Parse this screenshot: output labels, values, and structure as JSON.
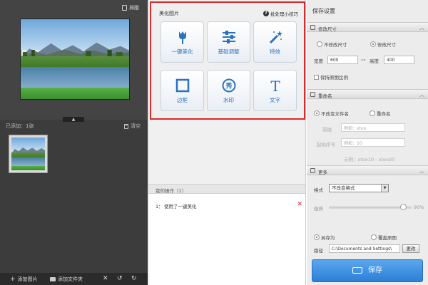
{
  "left_panel": {
    "sort_label": "排版",
    "added_label": "已添加：1张",
    "clear_label": "清空",
    "bottom": {
      "add_image": "添加图片",
      "add_folder": "添加文件夹"
    }
  },
  "beautify": {
    "title": "美化图片",
    "tips": "批处理小技巧",
    "tools": [
      {
        "label": "一键美化",
        "icon": "tulip-icon"
      },
      {
        "label": "基础调整",
        "icon": "sliders-icon"
      },
      {
        "label": "特效",
        "icon": "magic-wand-icon"
      },
      {
        "label": "边框",
        "icon": "frame-icon"
      },
      {
        "label": "水印",
        "icon": "watermark-icon"
      },
      {
        "label": "文字",
        "icon": "text-icon"
      }
    ]
  },
  "operations": {
    "title": "我的操作（1）",
    "items": [
      {
        "num": "1：",
        "text": "使用了一键美化"
      }
    ]
  },
  "save_settings": {
    "title": "保存设置",
    "size_section": "修改尺寸",
    "no_resize": "不修改尺寸",
    "resize": "修改尺寸",
    "width_label": "宽度",
    "width_value": "600",
    "height_label": "高度",
    "height_value": "400",
    "keep_ratio": "保持原图比例",
    "rename_section": "重命名",
    "no_rename": "不改变文件名",
    "rename": "重命名",
    "prefix_label": "前缀",
    "prefix_value": "例如：xtoo",
    "start_label": "起始序号",
    "start_value": "例如：10",
    "example": "示例：xtoo10 - xtoo20",
    "more_section": "更多",
    "format_label": "格式",
    "format_value": "不改变格式",
    "quality_label": "画质",
    "quality_value": "90%",
    "quality_level": 0.9,
    "save_as": "另存为",
    "overwrite": "覆盖原图",
    "path_label": "路径",
    "path_value": "C:\\Documents and Settings\\",
    "browse": "更改",
    "save_button": "保存"
  }
}
